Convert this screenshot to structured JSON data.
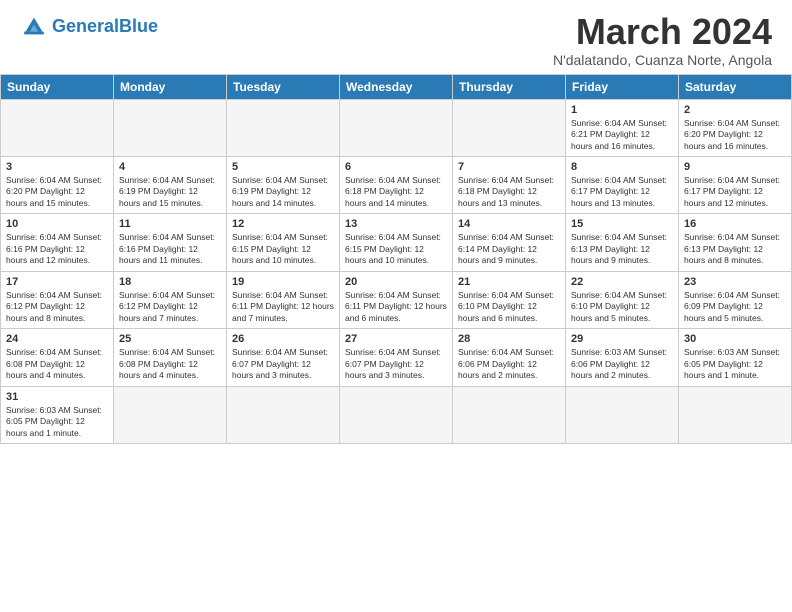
{
  "header": {
    "logo_general": "General",
    "logo_blue": "Blue",
    "month_title": "March 2024",
    "location": "N'dalatando, Cuanza Norte, Angola"
  },
  "weekdays": [
    "Sunday",
    "Monday",
    "Tuesday",
    "Wednesday",
    "Thursday",
    "Friday",
    "Saturday"
  ],
  "weeks": [
    [
      {
        "day": "",
        "info": ""
      },
      {
        "day": "",
        "info": ""
      },
      {
        "day": "",
        "info": ""
      },
      {
        "day": "",
        "info": ""
      },
      {
        "day": "",
        "info": ""
      },
      {
        "day": "1",
        "info": "Sunrise: 6:04 AM\nSunset: 6:21 PM\nDaylight: 12 hours and 16 minutes."
      },
      {
        "day": "2",
        "info": "Sunrise: 6:04 AM\nSunset: 6:20 PM\nDaylight: 12 hours and 16 minutes."
      }
    ],
    [
      {
        "day": "3",
        "info": "Sunrise: 6:04 AM\nSunset: 6:20 PM\nDaylight: 12 hours and 15 minutes."
      },
      {
        "day": "4",
        "info": "Sunrise: 6:04 AM\nSunset: 6:19 PM\nDaylight: 12 hours and 15 minutes."
      },
      {
        "day": "5",
        "info": "Sunrise: 6:04 AM\nSunset: 6:19 PM\nDaylight: 12 hours and 14 minutes."
      },
      {
        "day": "6",
        "info": "Sunrise: 6:04 AM\nSunset: 6:18 PM\nDaylight: 12 hours and 14 minutes."
      },
      {
        "day": "7",
        "info": "Sunrise: 6:04 AM\nSunset: 6:18 PM\nDaylight: 12 hours and 13 minutes."
      },
      {
        "day": "8",
        "info": "Sunrise: 6:04 AM\nSunset: 6:17 PM\nDaylight: 12 hours and 13 minutes."
      },
      {
        "day": "9",
        "info": "Sunrise: 6:04 AM\nSunset: 6:17 PM\nDaylight: 12 hours and 12 minutes."
      }
    ],
    [
      {
        "day": "10",
        "info": "Sunrise: 6:04 AM\nSunset: 6:16 PM\nDaylight: 12 hours and 12 minutes."
      },
      {
        "day": "11",
        "info": "Sunrise: 6:04 AM\nSunset: 6:16 PM\nDaylight: 12 hours and 11 minutes."
      },
      {
        "day": "12",
        "info": "Sunrise: 6:04 AM\nSunset: 6:15 PM\nDaylight: 12 hours and 10 minutes."
      },
      {
        "day": "13",
        "info": "Sunrise: 6:04 AM\nSunset: 6:15 PM\nDaylight: 12 hours and 10 minutes."
      },
      {
        "day": "14",
        "info": "Sunrise: 6:04 AM\nSunset: 6:14 PM\nDaylight: 12 hours and 9 minutes."
      },
      {
        "day": "15",
        "info": "Sunrise: 6:04 AM\nSunset: 6:13 PM\nDaylight: 12 hours and 9 minutes."
      },
      {
        "day": "16",
        "info": "Sunrise: 6:04 AM\nSunset: 6:13 PM\nDaylight: 12 hours and 8 minutes."
      }
    ],
    [
      {
        "day": "17",
        "info": "Sunrise: 6:04 AM\nSunset: 6:12 PM\nDaylight: 12 hours and 8 minutes."
      },
      {
        "day": "18",
        "info": "Sunrise: 6:04 AM\nSunset: 6:12 PM\nDaylight: 12 hours and 7 minutes."
      },
      {
        "day": "19",
        "info": "Sunrise: 6:04 AM\nSunset: 6:11 PM\nDaylight: 12 hours and 7 minutes."
      },
      {
        "day": "20",
        "info": "Sunrise: 6:04 AM\nSunset: 6:11 PM\nDaylight: 12 hours and 6 minutes."
      },
      {
        "day": "21",
        "info": "Sunrise: 6:04 AM\nSunset: 6:10 PM\nDaylight: 12 hours and 6 minutes."
      },
      {
        "day": "22",
        "info": "Sunrise: 6:04 AM\nSunset: 6:10 PM\nDaylight: 12 hours and 5 minutes."
      },
      {
        "day": "23",
        "info": "Sunrise: 6:04 AM\nSunset: 6:09 PM\nDaylight: 12 hours and 5 minutes."
      }
    ],
    [
      {
        "day": "24",
        "info": "Sunrise: 6:04 AM\nSunset: 6:08 PM\nDaylight: 12 hours and 4 minutes."
      },
      {
        "day": "25",
        "info": "Sunrise: 6:04 AM\nSunset: 6:08 PM\nDaylight: 12 hours and 4 minutes."
      },
      {
        "day": "26",
        "info": "Sunrise: 6:04 AM\nSunset: 6:07 PM\nDaylight: 12 hours and 3 minutes."
      },
      {
        "day": "27",
        "info": "Sunrise: 6:04 AM\nSunset: 6:07 PM\nDaylight: 12 hours and 3 minutes."
      },
      {
        "day": "28",
        "info": "Sunrise: 6:04 AM\nSunset: 6:06 PM\nDaylight: 12 hours and 2 minutes."
      },
      {
        "day": "29",
        "info": "Sunrise: 6:03 AM\nSunset: 6:06 PM\nDaylight: 12 hours and 2 minutes."
      },
      {
        "day": "30",
        "info": "Sunrise: 6:03 AM\nSunset: 6:05 PM\nDaylight: 12 hours and 1 minute."
      }
    ],
    [
      {
        "day": "31",
        "info": "Sunrise: 6:03 AM\nSunset: 6:05 PM\nDaylight: 12 hours and 1 minute."
      },
      {
        "day": "",
        "info": ""
      },
      {
        "day": "",
        "info": ""
      },
      {
        "day": "",
        "info": ""
      },
      {
        "day": "",
        "info": ""
      },
      {
        "day": "",
        "info": ""
      },
      {
        "day": "",
        "info": ""
      }
    ]
  ]
}
